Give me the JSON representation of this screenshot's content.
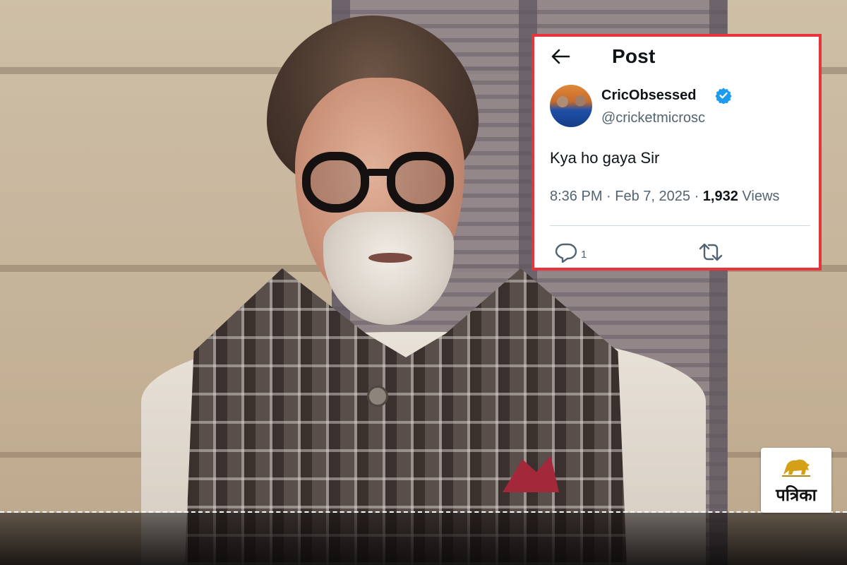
{
  "tweet": {
    "header_title": "Post",
    "user": {
      "display_name": "CricObsessed",
      "handle": "@cricketmicrosc",
      "verified": true
    },
    "text": "Kya ho gaya Sir",
    "time": "8:36 PM",
    "date": "Feb 7, 2025",
    "views_count": "1,932",
    "views_label": "Views",
    "reply_count": "1",
    "icons": {
      "back": "arrow-left",
      "verified": "verified-badge",
      "reply": "speech-bubble",
      "retweet": "repost-arrows"
    }
  },
  "brand": {
    "name": "पत्रिका",
    "emblem": "lion-emblem"
  },
  "colors": {
    "highlight_border": "#e8333a",
    "verified_blue": "#1d9bf0",
    "secondary_text": "#536471",
    "primary_text": "#0f1419",
    "emblem_gold": "#d4a017"
  }
}
